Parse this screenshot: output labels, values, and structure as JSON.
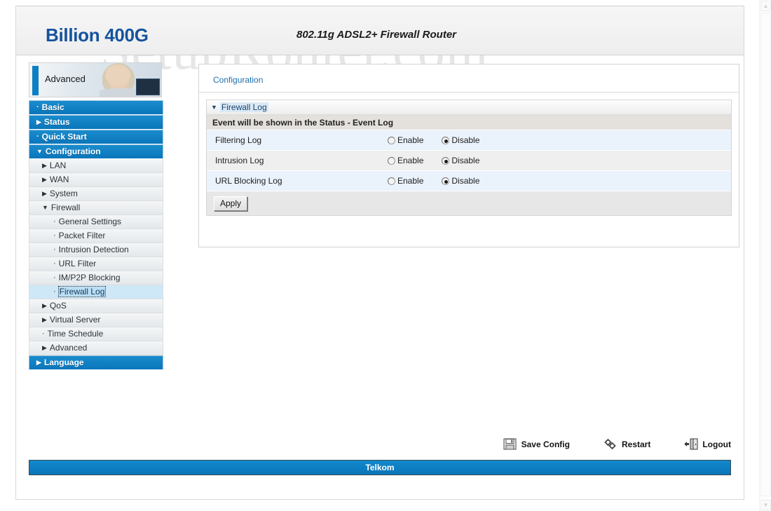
{
  "header": {
    "brand": "Billion 400G",
    "model_title": "802.11g ADSL2+ Firewall Router",
    "watermark": "SetupRouter.com"
  },
  "sidebar": {
    "banner_label": "Advanced",
    "banner_photo_icon": "person-with-laptop-photo",
    "items": [
      {
        "label": "Basic",
        "level": "top",
        "marker": "·",
        "selected": false
      },
      {
        "label": "Status",
        "level": "top",
        "marker": "▶",
        "selected": false
      },
      {
        "label": "Quick Start",
        "level": "top",
        "marker": "·",
        "selected": false
      },
      {
        "label": "Configuration",
        "level": "top",
        "marker": "▼",
        "selected": false
      },
      {
        "label": "LAN",
        "level": "sub",
        "marker": "▶",
        "selected": false
      },
      {
        "label": "WAN",
        "level": "sub",
        "marker": "▶",
        "selected": false
      },
      {
        "label": "System",
        "level": "sub",
        "marker": "▶",
        "selected": false
      },
      {
        "label": "Firewall",
        "level": "sub",
        "marker": "▼",
        "selected": false
      },
      {
        "label": "General Settings",
        "level": "sub2",
        "marker": "·",
        "selected": false
      },
      {
        "label": "Packet Filter",
        "level": "sub2",
        "marker": "·",
        "selected": false
      },
      {
        "label": "Intrusion Detection",
        "level": "sub2",
        "marker": "·",
        "selected": false
      },
      {
        "label": "URL Filter",
        "level": "sub2",
        "marker": "·",
        "selected": false
      },
      {
        "label": "IM/P2P Blocking",
        "level": "sub2",
        "marker": "·",
        "selected": false
      },
      {
        "label": "Firewall Log",
        "level": "sub2",
        "marker": "·",
        "selected": true
      },
      {
        "label": "QoS",
        "level": "sub",
        "marker": "▶",
        "selected": false
      },
      {
        "label": "Virtual Server",
        "level": "sub",
        "marker": "▶",
        "selected": false
      },
      {
        "label": "Time Schedule",
        "level": "sub",
        "marker": "·",
        "selected": false
      },
      {
        "label": "Advanced",
        "level": "sub",
        "marker": "▶",
        "selected": false
      },
      {
        "label": "Language",
        "level": "top",
        "marker": "▶",
        "selected": false
      }
    ]
  },
  "main": {
    "breadcrumb": "Configuration",
    "panel_title": "Firewall Log",
    "panel_title_marker": "▼",
    "note": "Event will be shown in the Status - Event Log",
    "enable_label": "Enable",
    "disable_label": "Disable",
    "rows": [
      {
        "label": "Filtering Log",
        "value": "Disable"
      },
      {
        "label": "Intrusion Log",
        "value": "Disable"
      },
      {
        "label": "URL Blocking Log",
        "value": "Disable"
      }
    ],
    "apply_label": "Apply"
  },
  "actions": [
    {
      "label": "Save Config",
      "icon": "floppy-disk-icon"
    },
    {
      "label": "Restart",
      "icon": "gears-icon"
    },
    {
      "label": "Logout",
      "icon": "exit-door-icon"
    }
  ],
  "footer": {
    "text": "Telkom"
  },
  "scrollbar": {
    "up": "▲",
    "down": "▼"
  },
  "colors": {
    "accent_blue": "#0d7fc4",
    "brand_blue": "#15539e",
    "row_blue": "#eaf2fb",
    "row_gray": "#efefef",
    "note_gray": "#e4e1dd"
  }
}
